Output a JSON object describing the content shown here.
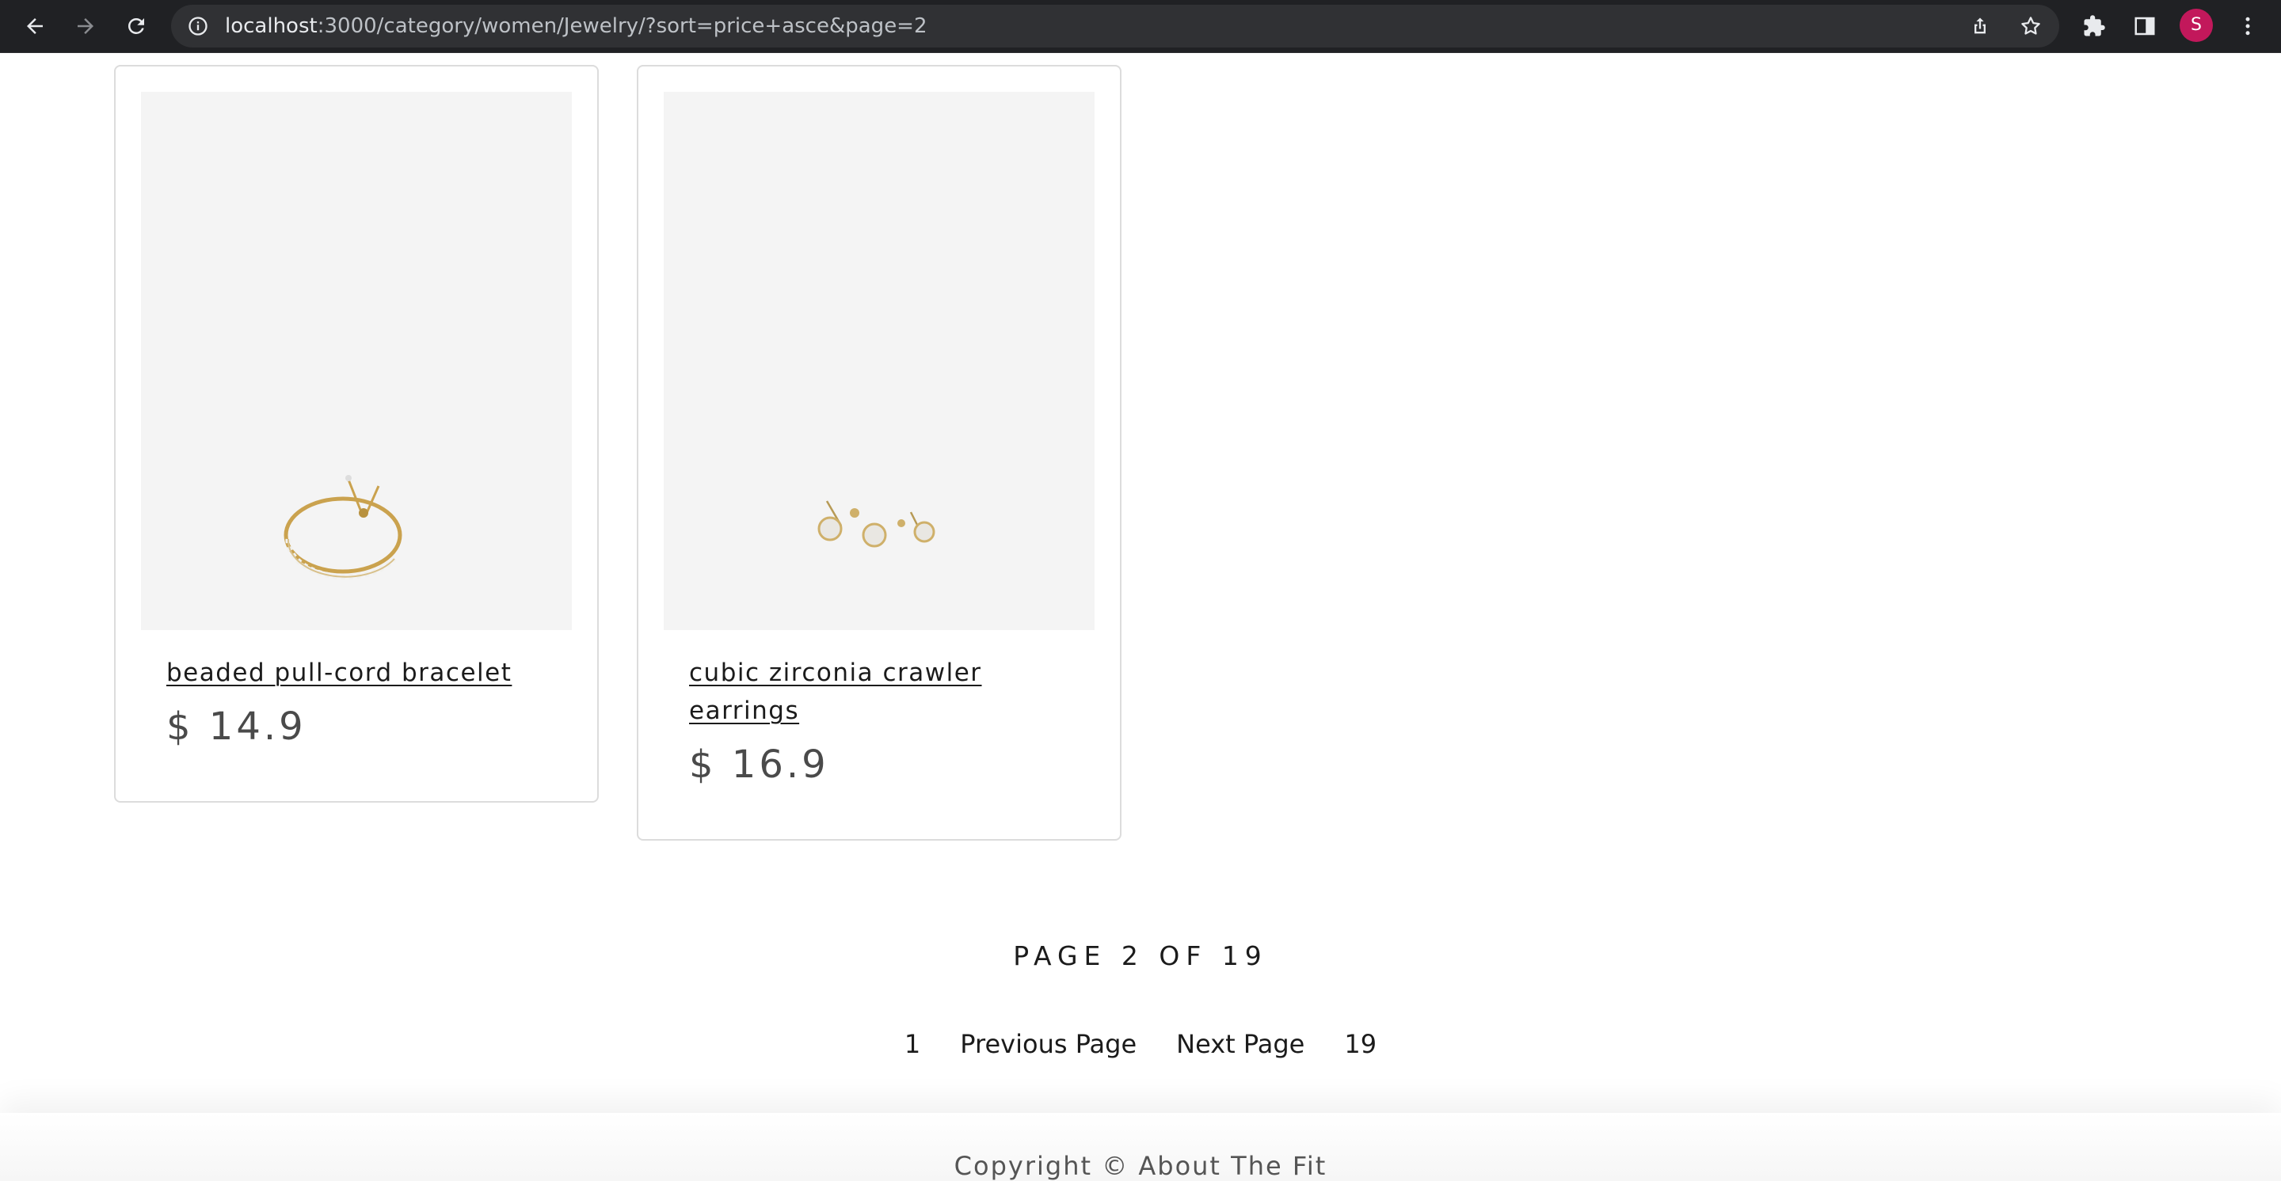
{
  "browser": {
    "url_host": "localhost",
    "url_rest": ":3000/category/women/Jewelry/?sort=price+asce&page=2",
    "profile_initial": "S"
  },
  "products": [
    {
      "name": "beaded pull-cord bracelet",
      "price": "$ 14.9",
      "image_alt": "bracelet"
    },
    {
      "name": "cubic zirconia crawler earrings",
      "price": "$ 16.9",
      "image_alt": "earrings"
    }
  ],
  "pagination": {
    "status": "PAGE 2 OF 19",
    "first": "1",
    "previous": "Previous Page",
    "next": "Next Page",
    "last": "19"
  },
  "footer": {
    "copyright": "Copyright © About The Fit"
  }
}
